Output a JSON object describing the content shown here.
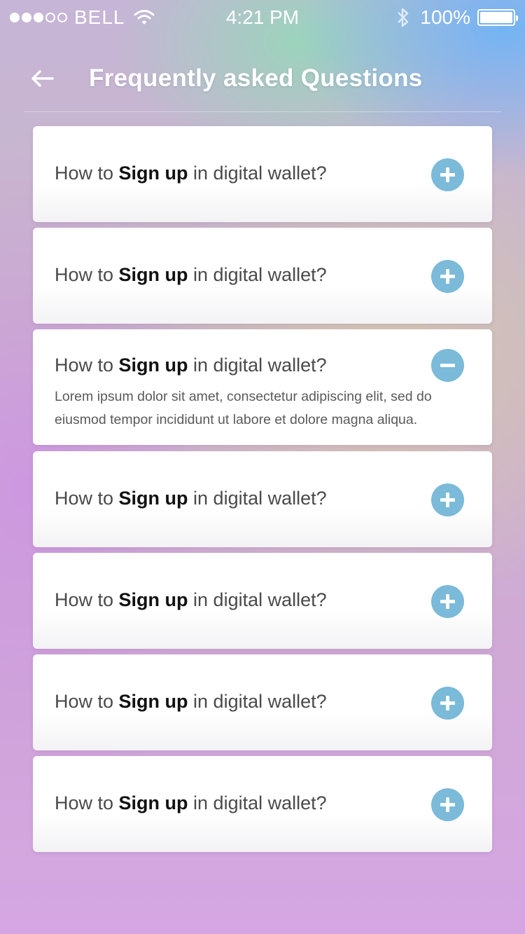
{
  "status_bar": {
    "carrier": "BELL",
    "time": "4:21 PM",
    "battery": "100%",
    "signal_strength": 3,
    "signal_total": 5
  },
  "header": {
    "title": "Frequently asked Questions",
    "back_icon": "back-arrow-icon"
  },
  "colors": {
    "toggle": "#7bbad9",
    "card": "#ffffff",
    "question_text": "#4a4a4a",
    "question_emphasis": "#111111"
  },
  "faq": {
    "items": [
      {
        "prefix": "How to ",
        "emphasis": "Sign up",
        "suffix": " in digital wallet?",
        "expanded": false,
        "toggle_icon": "plus-icon"
      },
      {
        "prefix": "How to ",
        "emphasis": "Sign up",
        "suffix": " in digital wallet?",
        "expanded": false,
        "toggle_icon": "plus-icon"
      },
      {
        "prefix": "How to ",
        "emphasis": "Sign up",
        "suffix": " in digital wallet?",
        "expanded": true,
        "toggle_icon": "minus-icon",
        "answer": "Lorem ipsum dolor sit amet, consectetur adipiscing elit, sed do eiusmod tempor incididunt ut labore et dolore magna aliqua."
      },
      {
        "prefix": "How to ",
        "emphasis": "Sign up",
        "suffix": " in digital wallet?",
        "expanded": false,
        "toggle_icon": "plus-icon"
      },
      {
        "prefix": "How to ",
        "emphasis": "Sign up",
        "suffix": " in digital wallet?",
        "expanded": false,
        "toggle_icon": "plus-icon"
      },
      {
        "prefix": "How to ",
        "emphasis": "Sign up",
        "suffix": " in digital wallet?",
        "expanded": false,
        "toggle_icon": "plus-icon"
      },
      {
        "prefix": "How to ",
        "emphasis": "Sign up",
        "suffix": " in digital wallet?",
        "expanded": false,
        "toggle_icon": "plus-icon"
      }
    ]
  }
}
